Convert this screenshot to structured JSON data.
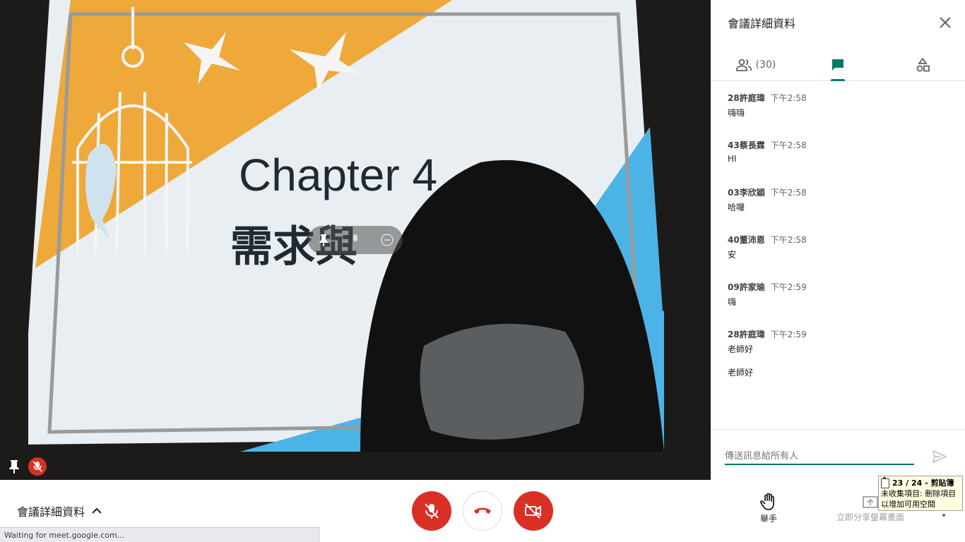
{
  "video": {
    "slide_title_en": "Chapter 4",
    "slide_title_zh": "需求與"
  },
  "panel": {
    "title": "會議詳細資料",
    "tabs": {
      "people_count": "(30)"
    },
    "messages": [
      {
        "sender": "28許庭瑋",
        "time": "下午2:58",
        "texts": [
          "嗨嗨"
        ]
      },
      {
        "sender": "43蔡長霖",
        "time": "下午2:58",
        "texts": [
          "HI"
        ]
      },
      {
        "sender": "03李欣穎",
        "time": "下午2:58",
        "texts": [
          "哈囉"
        ]
      },
      {
        "sender": "40董沛恩",
        "time": "下午2:58",
        "texts": [
          "安"
        ]
      },
      {
        "sender": "09許家瑜",
        "time": "下午2:59",
        "texts": [
          "嗨"
        ]
      },
      {
        "sender": "28許庭瑋",
        "time": "下午2:59",
        "texts": [
          "老師好",
          "老師好"
        ]
      }
    ],
    "compose_placeholder": "傳送訊息給所有人"
  },
  "bottombar": {
    "details_label": "會議詳細資料",
    "raise_hand_label": "舉手",
    "present_label": "立即分享螢幕畫面"
  },
  "status_text": "Waiting for meet.google.com...",
  "tooltip": {
    "line1": "23 / 24 - 剪貼簿",
    "line2": "未收集項目: 刪除項目",
    "line3": "以增加可用空間"
  },
  "colors": {
    "accent": "#00796b",
    "danger": "#d93025"
  }
}
